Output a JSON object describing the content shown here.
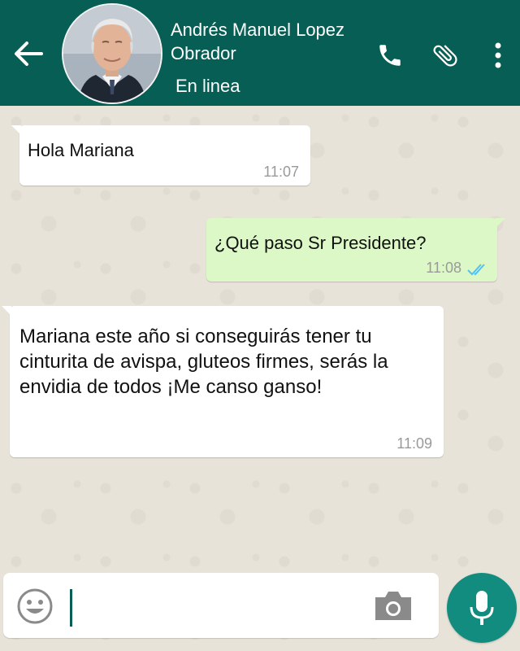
{
  "header": {
    "contact_name": "Andrés Manuel Lopez Obrador",
    "status": "En linea",
    "background_color": "#075e54"
  },
  "icons": {
    "back": "arrow-left-icon",
    "call": "phone-icon",
    "attach": "paperclip-icon",
    "menu": "more-vertical-icon",
    "emoji": "smiley-icon",
    "camera": "camera-icon",
    "mic": "mic-icon"
  },
  "messages": [
    {
      "direction": "incoming",
      "text": "Hola Mariana",
      "time": "11:07"
    },
    {
      "direction": "outgoing",
      "text": "¿Qué paso Sr Presidente?",
      "time": "11:08",
      "read": true
    },
    {
      "direction": "incoming",
      "text": "Mariana este año si conseguirás tener tu cinturita de avispa, gluteos firmes, serás la envidia de todos ¡Me canso ganso!",
      "time": "11:09"
    }
  ],
  "input": {
    "value": "",
    "placeholder": ""
  },
  "colors": {
    "incoming_bubble": "#ffffff",
    "outgoing_bubble": "#dcf8c6",
    "read_ticks": "#4fc3f7",
    "mic_button": "#128c7e"
  }
}
